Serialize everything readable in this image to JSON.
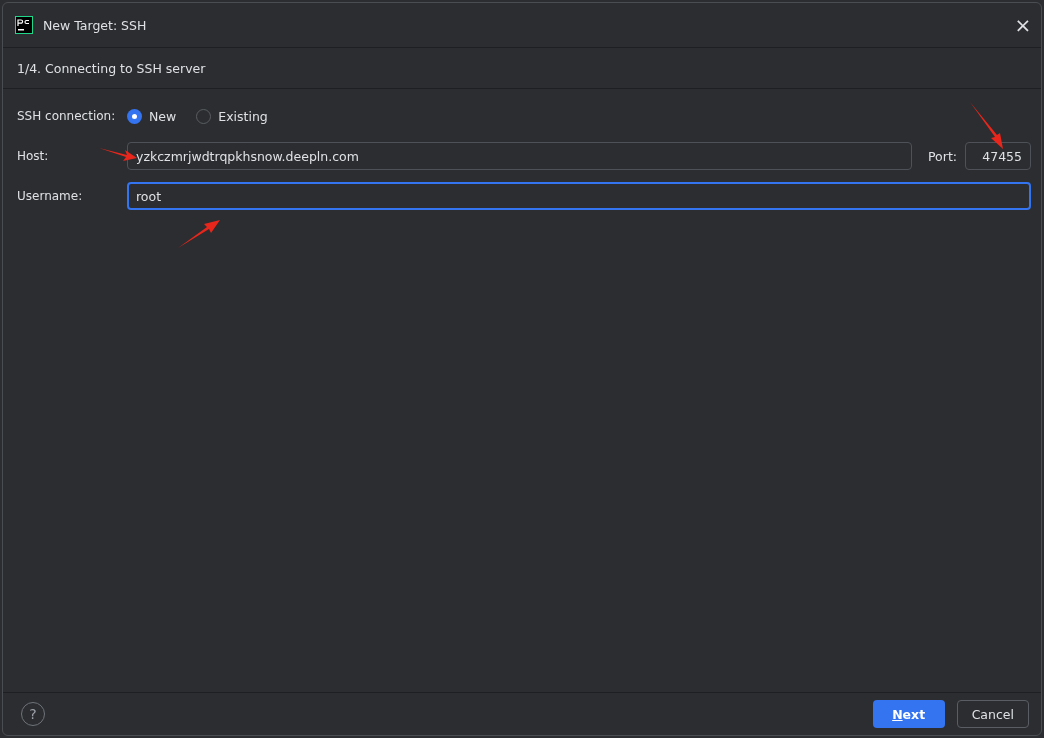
{
  "window": {
    "title": "New Target: SSH",
    "close": "×"
  },
  "step": "1/4. Connecting to SSH server",
  "connection": {
    "label": "SSH connection:",
    "options": [
      {
        "label": "New",
        "selected": true
      },
      {
        "label": "Existing",
        "selected": false
      }
    ]
  },
  "host": {
    "label": "Host:",
    "value": "yzkczmrjwdtrqpkhsnow.deepln.com",
    "port_label": "Port:",
    "port": "47455"
  },
  "username": {
    "label": "Username:",
    "value": "root",
    "focused": true
  },
  "footer": {
    "help": "?",
    "buttons": [
      {
        "label": "Next",
        "kind": "primary"
      },
      {
        "label": "Cancel",
        "kind": "secondary"
      }
    ]
  }
}
